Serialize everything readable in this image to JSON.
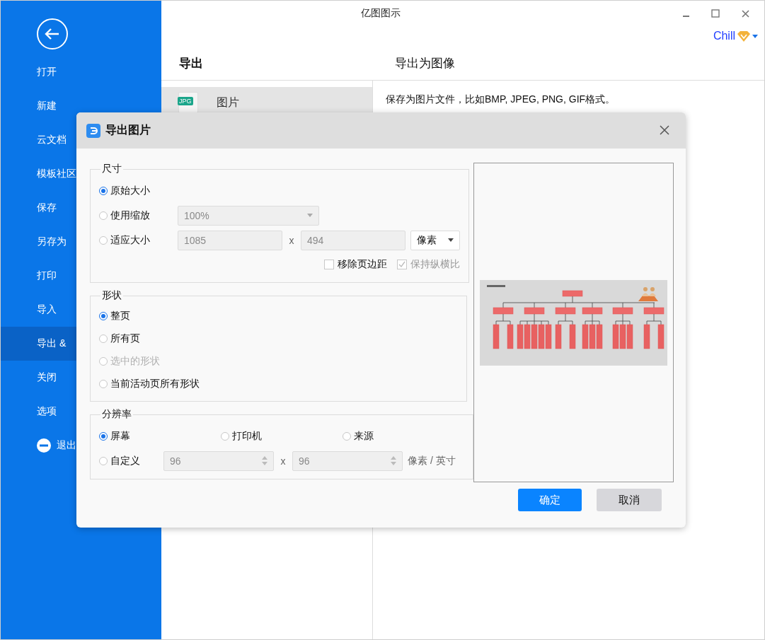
{
  "window": {
    "title": "亿图图示",
    "user": "Chill"
  },
  "sidebar": {
    "items": [
      {
        "label": "打开",
        "kind": "text",
        "selected": false
      },
      {
        "label": "新建",
        "kind": "text",
        "selected": false
      },
      {
        "label": "云文档",
        "kind": "text",
        "selected": false
      },
      {
        "label": "模板社区",
        "kind": "text",
        "selected": false
      },
      {
        "label": "保存",
        "kind": "text",
        "selected": false
      },
      {
        "label": "另存为",
        "kind": "text",
        "selected": false
      },
      {
        "label": "打印",
        "kind": "text",
        "selected": false
      },
      {
        "label": "导入",
        "kind": "text",
        "selected": false
      },
      {
        "label": "导出 &",
        "kind": "text",
        "selected": true
      },
      {
        "label": "关闭",
        "kind": "text",
        "selected": false
      },
      {
        "label": "选项",
        "kind": "text",
        "selected": false
      },
      {
        "label": "退出",
        "kind": "exit",
        "selected": false
      }
    ]
  },
  "export_panel": {
    "heading": "导出",
    "items": [
      {
        "label": "图片",
        "badge": "JPG",
        "selected": true
      }
    ]
  },
  "detail": {
    "heading": "导出为图像",
    "description": "保存为图片文件，比如BMP, JPEG, PNG, GIF格式。"
  },
  "dialog": {
    "title": "导出图片",
    "size": {
      "legend": "尺寸",
      "options": [
        {
          "label": "原始大小",
          "selected": true
        },
        {
          "label": "使用缩放",
          "selected": false
        },
        {
          "label": "适应大小",
          "selected": false
        }
      ],
      "scale": {
        "value": "100%",
        "disabled": true
      },
      "width": {
        "value": "1085",
        "disabled": true
      },
      "separator": "x",
      "height": {
        "value": "494",
        "disabled": true
      },
      "unit": "像素",
      "remove_margin": {
        "label": "移除页边距",
        "checked": false,
        "disabled": false
      },
      "keep_ratio": {
        "label": "保持纵横比",
        "checked": true,
        "disabled": true
      }
    },
    "shape": {
      "legend": "形状",
      "options": [
        {
          "label": "整页",
          "selected": true,
          "disabled": false
        },
        {
          "label": "所有页",
          "selected": false,
          "disabled": false
        },
        {
          "label": "选中的形状",
          "selected": false,
          "disabled": true
        },
        {
          "label": "当前活动页所有形状",
          "selected": false,
          "disabled": false
        }
      ]
    },
    "resolution": {
      "legend": "分辨率",
      "options": [
        {
          "label": "屏幕",
          "selected": true
        },
        {
          "label": "打印机",
          "selected": false
        },
        {
          "label": "来源",
          "selected": false
        },
        {
          "label": "自定义",
          "selected": false
        }
      ],
      "x": {
        "value": "96",
        "disabled": true
      },
      "separator": "x",
      "y": {
        "value": "96",
        "disabled": true
      },
      "unit": "像素 / 英寸"
    },
    "buttons": [
      {
        "label": "确定",
        "kind": "primary"
      },
      {
        "label": "取消",
        "kind": "secondary"
      }
    ]
  }
}
